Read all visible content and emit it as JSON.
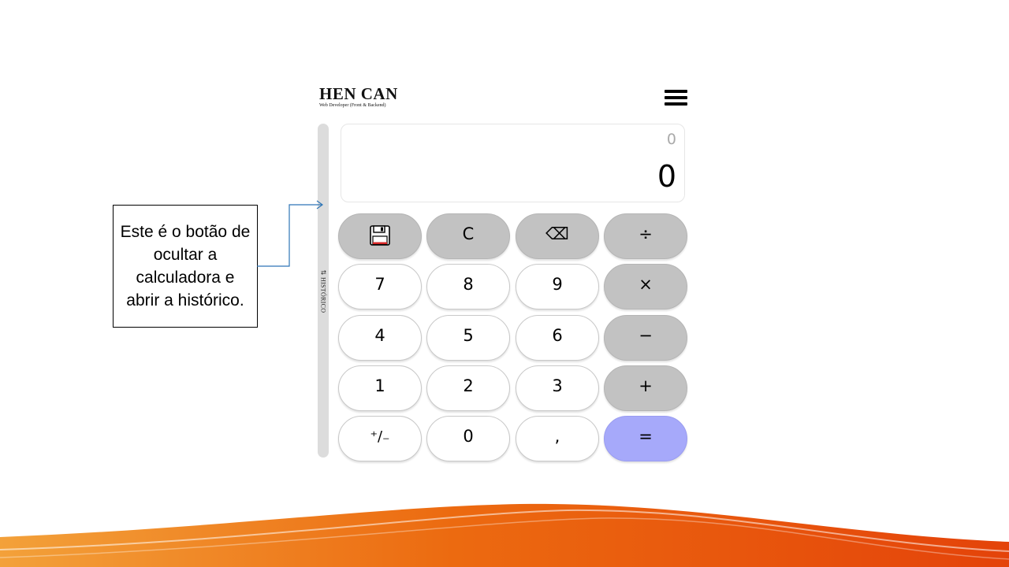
{
  "brand": {
    "name": "HEN CAN",
    "subtitle": "Web Developer (Front & Backend)"
  },
  "menu": {
    "icon": "hamburger-menu-icon"
  },
  "history_toggle": {
    "label": "⇅ HISTÓRICO"
  },
  "display": {
    "expression": "0",
    "value": "0"
  },
  "keys": [
    {
      "id": "save",
      "label": "",
      "icon": "floppy-disk-icon",
      "type": "fn"
    },
    {
      "id": "clear",
      "label": "C",
      "type": "fn"
    },
    {
      "id": "backspace",
      "label": "⌫",
      "icon": "backspace-icon",
      "type": "fn"
    },
    {
      "id": "divide",
      "label": "÷",
      "type": "fn"
    },
    {
      "id": "seven",
      "label": "7",
      "type": "num"
    },
    {
      "id": "eight",
      "label": "8",
      "type": "num"
    },
    {
      "id": "nine",
      "label": "9",
      "type": "num"
    },
    {
      "id": "multiply",
      "label": "×",
      "type": "fn"
    },
    {
      "id": "four",
      "label": "4",
      "type": "num"
    },
    {
      "id": "five",
      "label": "5",
      "type": "num"
    },
    {
      "id": "six",
      "label": "6",
      "type": "num"
    },
    {
      "id": "subtract",
      "label": "−",
      "type": "fn"
    },
    {
      "id": "one",
      "label": "1",
      "type": "num"
    },
    {
      "id": "two",
      "label": "2",
      "type": "num"
    },
    {
      "id": "three",
      "label": "3",
      "type": "num"
    },
    {
      "id": "add",
      "label": "+",
      "type": "fn"
    },
    {
      "id": "negate",
      "label": "⁺/₋",
      "type": "num"
    },
    {
      "id": "zero",
      "label": "0",
      "type": "num"
    },
    {
      "id": "decimal",
      "label": ",",
      "type": "num"
    },
    {
      "id": "equals",
      "label": "=",
      "type": "eq"
    }
  ],
  "annotation": {
    "text": "Este é o botão de ocultar a calculadora e abrir a histórico."
  },
  "colors": {
    "function_key": "#c2c2c2",
    "equals_key": "#a6a9fa",
    "wave_orange": "#e8590c",
    "connector": "#2e75b6"
  }
}
